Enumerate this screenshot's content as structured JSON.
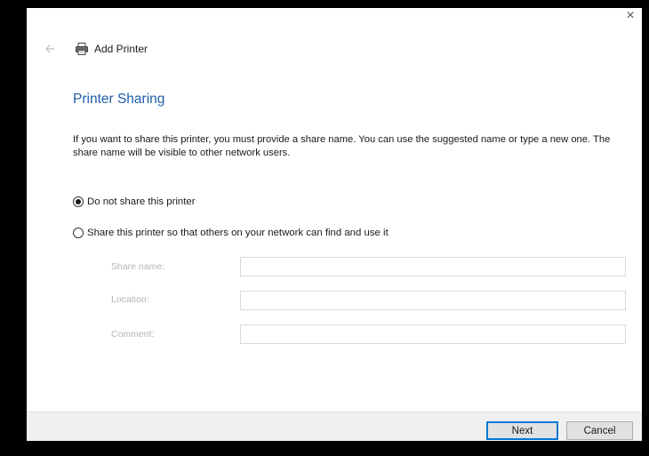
{
  "window": {
    "close_glyph": "×"
  },
  "header": {
    "back_icon": "back-arrow-icon",
    "printer_icon": "printer-icon",
    "title": "Add Printer"
  },
  "page": {
    "title": "Printer Sharing",
    "description": "If you want to share this printer, you must provide a share name. You can use the suggested name or type a new one. The share name will be visible to other network users."
  },
  "sharing_options": [
    {
      "label": "Do not share this printer",
      "selected": true
    },
    {
      "label": "Share this printer so that others on your network can find and use it",
      "selected": false
    }
  ],
  "fields": {
    "share_name": {
      "label": "Share name:",
      "value": ""
    },
    "location": {
      "label": "Location:",
      "value": ""
    },
    "comment": {
      "label": "Comment:",
      "value": ""
    }
  },
  "buttons": {
    "next_label": "Next",
    "cancel_label": "Cancel"
  },
  "colors": {
    "title_accent": "#1e5fa8",
    "default_button_border": "#0078d7",
    "disabled_text": "#b4b4b4"
  }
}
